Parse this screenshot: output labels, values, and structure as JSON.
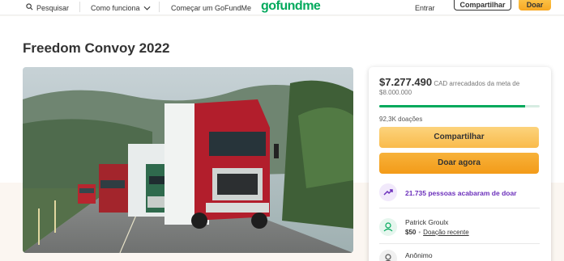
{
  "header": {
    "search_label": "Pesquisar",
    "how_label": "Como funciona",
    "start_label": "Começar um GoFundMe",
    "logo_text": "gofundme",
    "login_label": "Entrar",
    "share_label": "Compartilhar",
    "donate_label": "Doar"
  },
  "campaign": {
    "title": "Freedom Convoy 2022"
  },
  "card": {
    "amount": "$7.277.490",
    "amount_suffix": "CAD arrecadados da meta de $8.000.000",
    "progress_fraction": 0.91,
    "donations": "92,3K doações",
    "share_label": "Compartilhar",
    "donate_label": "Doar agora",
    "trend_text": "21.735 pessoas acabaram de doar"
  },
  "donors": [
    {
      "name": "Patrick Groulx",
      "amount": "$50",
      "note": "Doação recente"
    },
    {
      "name": "Anônimo"
    }
  ],
  "colors": {
    "brand_green": "#02a95c",
    "button_orange": "#f7a823",
    "trend_purple": "#6b2fbb"
  }
}
